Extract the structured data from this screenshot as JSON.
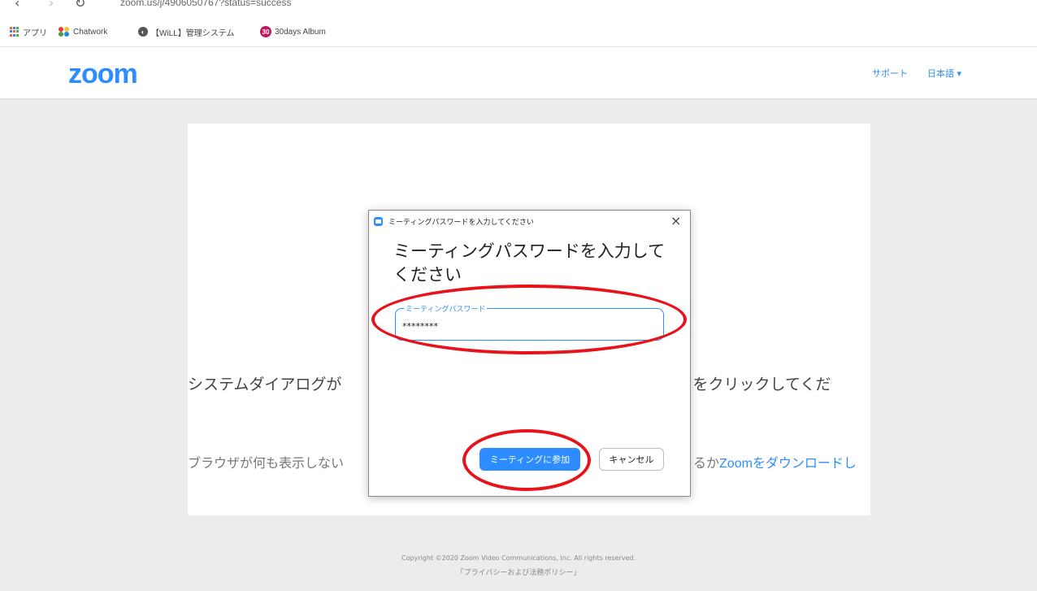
{
  "browser": {
    "back_glyph": "‹",
    "forward_glyph": "›",
    "reload_glyph": "↻",
    "url": "zoom.us/j/4906050767?status=success",
    "bookmarks": [
      {
        "label": "アプリ",
        "icon": "apps-grid-icon"
      },
      {
        "label": "Chatwork",
        "icon": "chatwork-icon"
      },
      {
        "label": "【WiLL】管理システム",
        "icon": "globe-icon"
      },
      {
        "label": "30days Album",
        "icon": "album-icon",
        "badge": "30"
      }
    ]
  },
  "header": {
    "logo": "zoom",
    "support": "サポート",
    "language": "日本語 ▾",
    "logo_color": "#2d8cff"
  },
  "main": {
    "line1_left": "システムダイアログが",
    "line1_right": "] をクリックしてくだ",
    "line2_left": "ブラウザが何も表示しない",
    "line2_right_prefix": "るか",
    "line2_right_link": "Zoomをダウンロードし"
  },
  "dialog": {
    "title": "ミーティングパスワードを入力してください",
    "close_glyph": "×",
    "heading": "ミーティングパスワードを入力してください",
    "password_label": "ミーティングパスワード",
    "password_value": "********",
    "join_button": "ミーティングに参加",
    "cancel_button": "キャンセル",
    "accent_color": "#2d8cff"
  },
  "annotation": {
    "highlight_color": "#e8121a"
  },
  "footer": {
    "copyright": "Copyright ©2020 Zoom Video Communications, Inc. All rights reserved.",
    "privacy": "「プライバシーおよび法務ポリシー」"
  }
}
